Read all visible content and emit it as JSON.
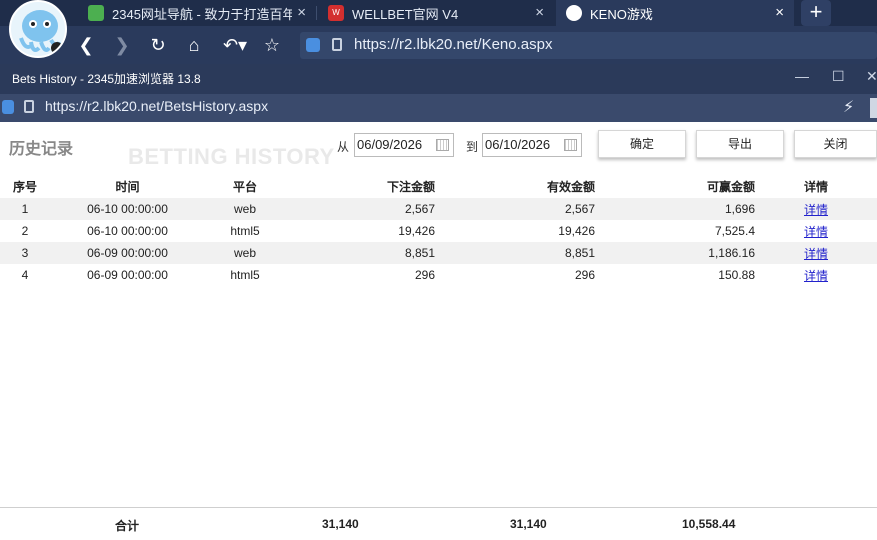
{
  "browser": {
    "tabs": [
      {
        "title": "2345网址导航 - 致力于打造百年",
        "close": "×"
      },
      {
        "title": "WELLBET官网 V4",
        "close": "×"
      },
      {
        "title": "KENO游戏",
        "close": "×",
        "active": true
      }
    ],
    "new_tab": "+",
    "url": "https://r2.lbk20.net/Keno.aspx"
  },
  "window": {
    "title": "Bets History - 2345加速浏览器 13.8",
    "url": "https://r2.lbk20.net/BetsHistory.aspx"
  },
  "page": {
    "title": "历史记录",
    "watermark": "BETTING HISTORY",
    "from_label": "从",
    "from_date": "06/09/2026",
    "to_label": "到",
    "to_date": "06/10/2026",
    "buttons": {
      "confirm": "确定",
      "export": "导出",
      "close": "关闭"
    }
  },
  "table": {
    "headers": [
      "序号",
      "时间",
      "平台",
      "下注金额",
      "有效金额",
      "可赢金额",
      "详情"
    ],
    "rows": [
      [
        "1",
        "06-10 00:00:00",
        "web",
        "2,567",
        "2,567",
        "1,696",
        "详情"
      ],
      [
        "2",
        "06-10 00:00:00",
        "html5",
        "19,426",
        "19,426",
        "7,525.4",
        "详情"
      ],
      [
        "3",
        "06-09 00:00:00",
        "web",
        "8,851",
        "8,851",
        "1,186.16",
        "详情"
      ],
      [
        "4",
        "06-09 00:00:00",
        "html5",
        "296",
        "296",
        "150.88",
        "详情"
      ]
    ]
  },
  "totals": {
    "label": "合计",
    "bet": "31,140",
    "valid": "31,140",
    "win": "10,558.44"
  },
  "colors": {
    "tabbar": "#1f2d4a",
    "navbar": "#2a3a5c",
    "link": "#2222cc",
    "row_stripe": "#f1f1f1"
  }
}
